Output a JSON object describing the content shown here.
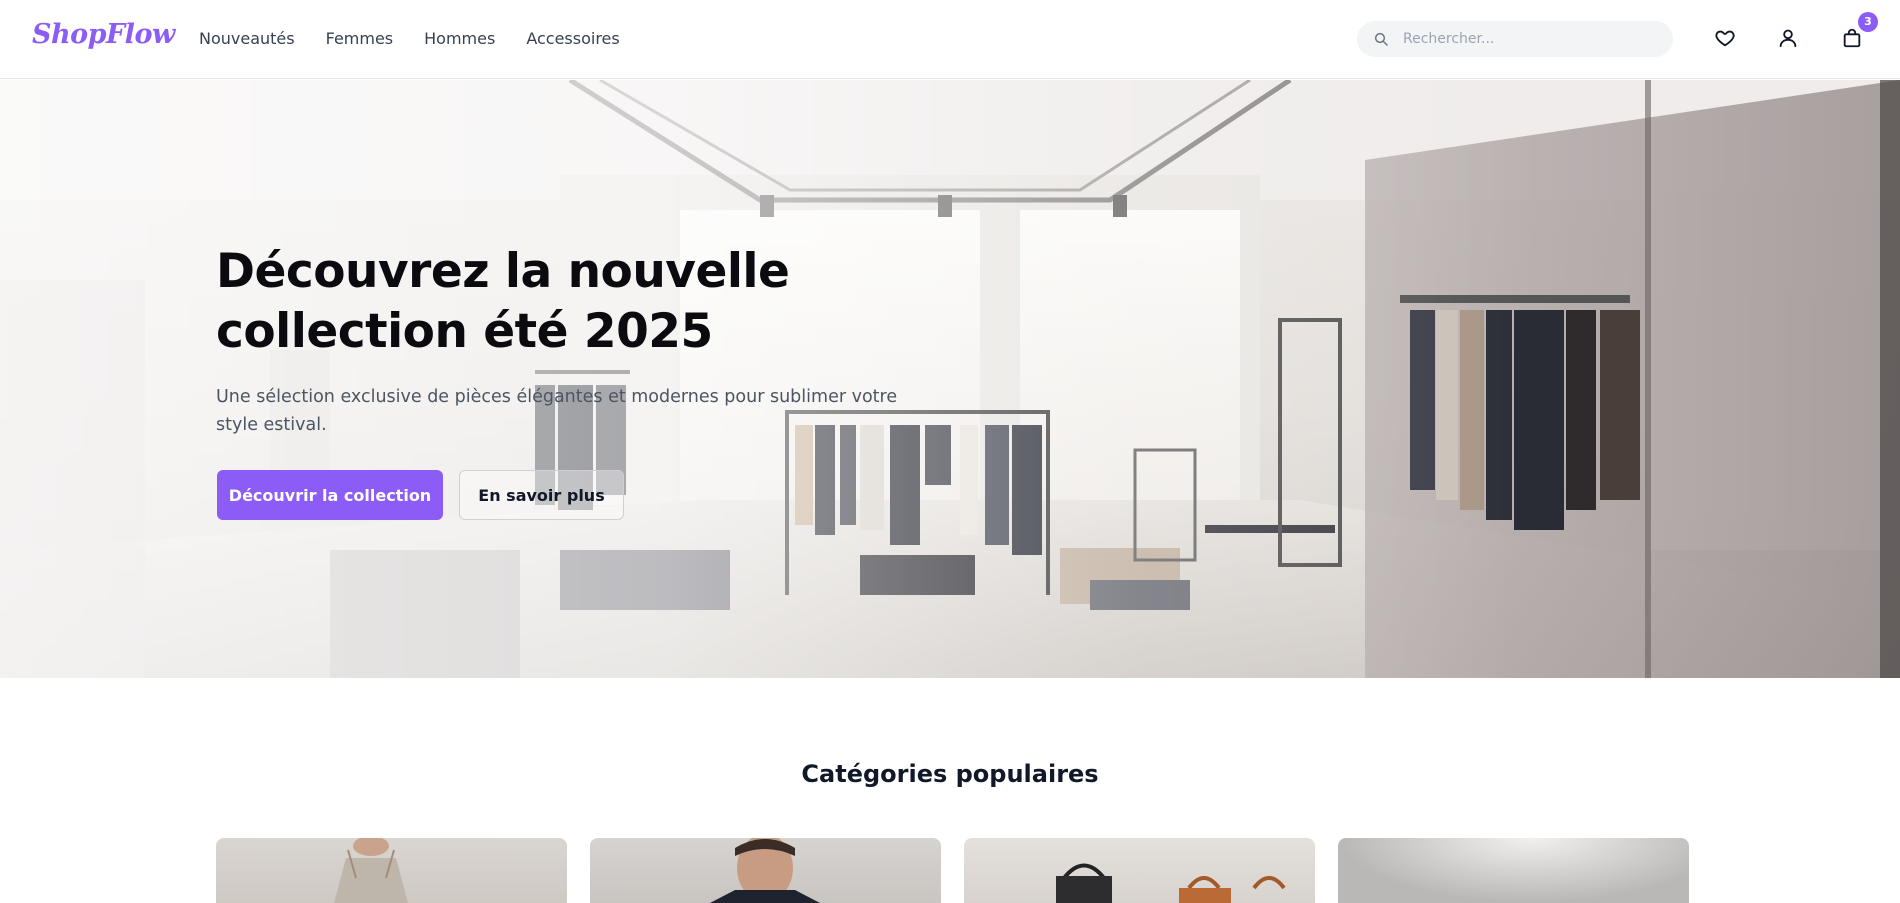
{
  "brand": {
    "logo_text": "ShopFlow",
    "accent_color": "#8b5cf6"
  },
  "nav": {
    "items": [
      {
        "label": "Nouveautés"
      },
      {
        "label": "Femmes"
      },
      {
        "label": "Hommes"
      },
      {
        "label": "Accessoires"
      }
    ]
  },
  "search": {
    "placeholder": "Rechercher...",
    "value": "",
    "icon": "search-icon"
  },
  "header_icons": {
    "wishlist": "heart-icon",
    "account": "user-icon",
    "cart": "shopping-bag-icon",
    "cart_count": "3"
  },
  "hero": {
    "title_line1": "Découvrez la nouvelle",
    "title_line2": "collection été 2025",
    "subtitle": "Une sélection exclusive de pièces élégantes et modernes pour sublimer votre style estival.",
    "primary_button": "Découvrir la collection",
    "secondary_button": "En savoir plus",
    "image": "boutique-interior-photo"
  },
  "categories": {
    "title": "Catégories populaires",
    "cards": [
      {
        "image": "woman-dress-photo"
      },
      {
        "image": "man-shirt-photo"
      },
      {
        "image": "handbags-photo"
      },
      {
        "image": "accessories-photo"
      }
    ]
  }
}
